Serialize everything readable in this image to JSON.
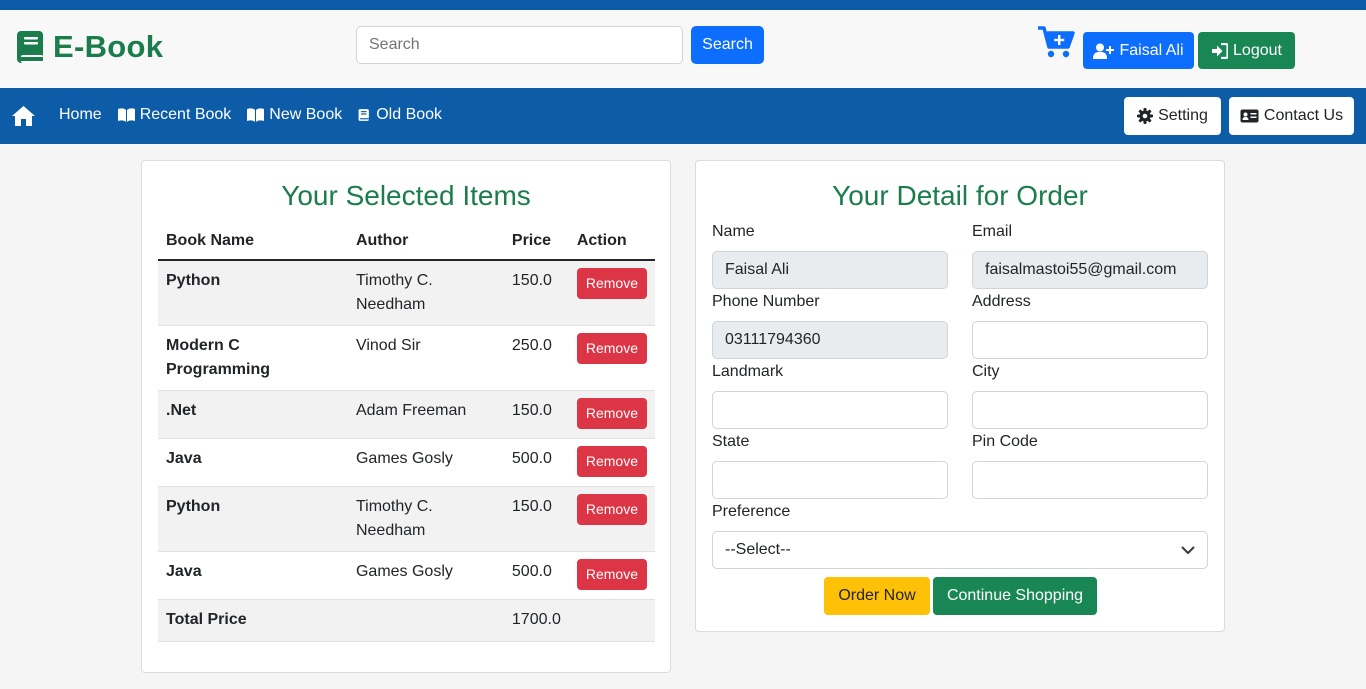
{
  "brand": {
    "name": "E-Book",
    "color": "#1b7d4c"
  },
  "search": {
    "placeholder": "Search",
    "button_label": "Search"
  },
  "header": {
    "user_label": "Faisal Ali",
    "logout_label": "Logout"
  },
  "nav": {
    "items": [
      {
        "label": "Home",
        "icon": "home-icon"
      },
      {
        "label": "Recent Book",
        "icon": "book-open-icon"
      },
      {
        "label": "New Book",
        "icon": "book-open-icon"
      },
      {
        "label": "Old Book",
        "icon": "book-icon"
      }
    ],
    "setting_label": "Setting",
    "contact_label": "Contact Us"
  },
  "cart": {
    "title": "Your Selected Items",
    "columns": [
      "Book Name",
      "Author",
      "Price",
      "Action"
    ],
    "rows": [
      {
        "book": "Python",
        "author": "Timothy C. Needham",
        "price": "150.0",
        "action": "Remove"
      },
      {
        "book": "Modern C Programming",
        "author": "Vinod Sir",
        "price": "250.0",
        "action": "Remove"
      },
      {
        "book": ".Net",
        "author": "Adam Freeman",
        "price": "150.0",
        "action": "Remove"
      },
      {
        "book": "Java",
        "author": "Games Gosly",
        "price": "500.0",
        "action": "Remove"
      },
      {
        "book": "Python",
        "author": "Timothy C. Needham",
        "price": "150.0",
        "action": "Remove"
      },
      {
        "book": "Java",
        "author": "Games Gosly",
        "price": "500.0",
        "action": "Remove"
      }
    ],
    "total_label": "Total Price",
    "total_value": "1700.0"
  },
  "order": {
    "title": "Your Detail for Order",
    "name_label": "Name",
    "name_value": "Faisal Ali",
    "email_label": "Email",
    "email_value": "faisalmastoi55@gmail.com",
    "phone_label": "Phone Number",
    "phone_value": "03111794360",
    "address_label": "Address",
    "address_value": "",
    "landmark_label": "Landmark",
    "landmark_value": "",
    "city_label": "City",
    "city_value": "",
    "state_label": "State",
    "state_value": "",
    "pin_label": "Pin Code",
    "pin_value": "",
    "preference_label": "Preference",
    "preference_selected": "--Select--",
    "order_button": "Order Now",
    "continue_button": "Continue Shopping"
  },
  "colors": {
    "primary": "#0d6efd",
    "success": "#198754",
    "danger": "#dc3545",
    "warning": "#ffc107",
    "navbar": "#0d5ca8"
  }
}
